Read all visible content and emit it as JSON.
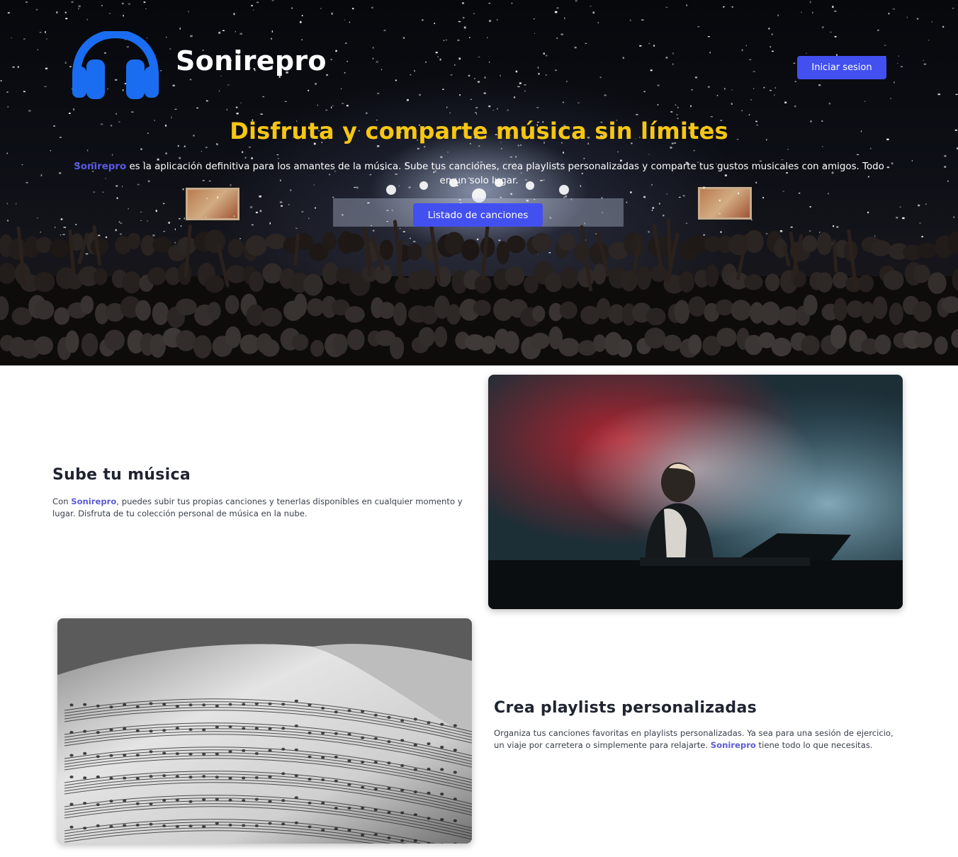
{
  "header": {
    "brand": "Sonirepro",
    "login_button": "Iniciar sesion",
    "logo_icon": "headphones-icon"
  },
  "hero": {
    "title": "Disfruta y comparte música sin límites",
    "brand": "Sonirepro",
    "description_rest": " es la aplicación definitiva para los amantes de la música. Sube tus canciones, crea playlists personalizadas y comparte tus gustos musicales con amigos. Todo en un solo lugar.",
    "cta_button": "Listado de canciones",
    "background_image": "concert-crowd-confetti"
  },
  "features": [
    {
      "title": "Sube tu música",
      "text_before": "Con ",
      "brand": "Sonirepro",
      "text_after": ", puedes subir tus propias canciones y tenerlas disponibles en cualquier momento y lugar. Disfruta de tu colección personal de música en la nube.",
      "image": "pianist-stage-smoke"
    },
    {
      "title": "Crea playlists personalizadas",
      "text_before": "Organiza tus canciones favoritas en playlists personalizadas. Ya sea para una sesión de ejercicio, un viaje por carretera o simplemente para relajarte. ",
      "brand": "Sonirepro",
      "text_after": " tiene todo lo que necesitas.",
      "image": "sheet-music-book"
    }
  ],
  "colors": {
    "accent": "#4250f0",
    "title_yellow": "#f7c613",
    "brand_purple": "#5b5bd6",
    "logo_blue": "#1a6df0"
  }
}
